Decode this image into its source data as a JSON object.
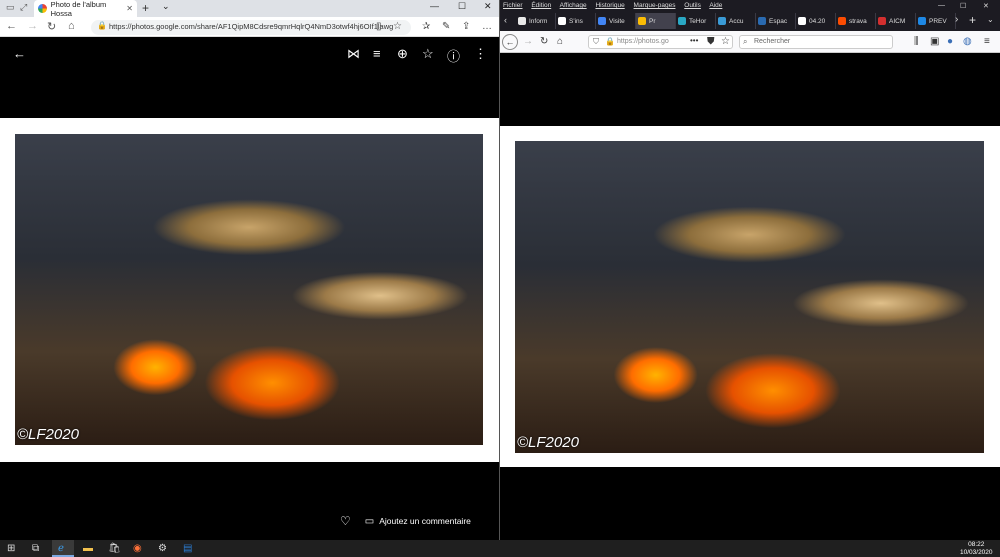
{
  "edge": {
    "tab_title": "Photo de l'album Hossa",
    "url": "https://photos.google.com/share/AF1QipM8Cdsre9qmrHqlrQ4NmD3otwf4hj6OIf1lawg",
    "new_tab": "+",
    "window_buttons": [
      "—",
      "☐",
      "✕"
    ]
  },
  "gphotos": {
    "watermark": "©LF2020",
    "comment_label": "Ajoutez un commentaire"
  },
  "firefox": {
    "menu": [
      "Fichier",
      "Édition",
      "Affichage",
      "Historique",
      "Marque-pages",
      "Outils",
      "Aide"
    ],
    "tabs": [
      {
        "label": "Inform",
        "color": "#e8e8e8"
      },
      {
        "label": "S'ins",
        "color": "#ffffff"
      },
      {
        "label": "Visite",
        "color": "#4285f4"
      },
      {
        "label": "Pr",
        "color": "#fbbc05"
      },
      {
        "label": "TeHor",
        "color": "#2aa8c4"
      },
      {
        "label": "Accu",
        "color": "#3a9bd6"
      },
      {
        "label": "Espac",
        "color": "#2a6ab0"
      },
      {
        "label": "04.20",
        "color": "#ffffff"
      },
      {
        "label": "strava",
        "color": "#fc4c02"
      },
      {
        "label": "AICM",
        "color": "#d32f2f"
      },
      {
        "label": "PREV",
        "color": "#1e88e5"
      }
    ],
    "url": "https://photos.go",
    "search_placeholder": "Rechercher"
  },
  "right_photo": {
    "watermark": "©LF2020"
  },
  "taskbar": {
    "time": "08:22",
    "date": "10/03/2020"
  }
}
